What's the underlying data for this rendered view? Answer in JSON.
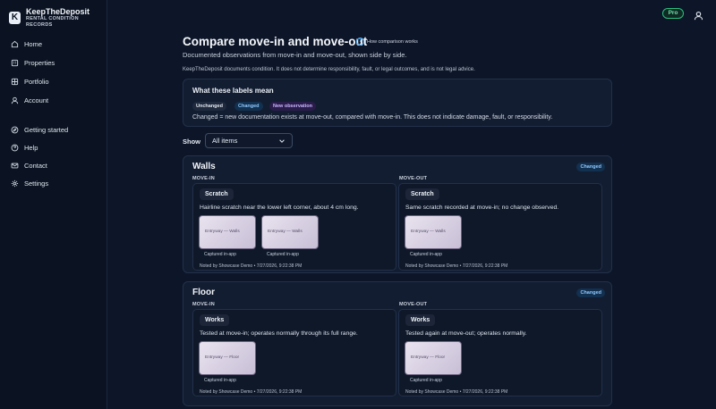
{
  "app": {
    "name": "KeepTheDeposit",
    "tagline": "RENTAL CONDITION RECORDS",
    "logo_letter": "K",
    "plan_badge": "Pro"
  },
  "sidebar": {
    "primary": [
      {
        "label": "Home",
        "icon": "home-icon"
      },
      {
        "label": "Properties",
        "icon": "building-icon"
      },
      {
        "label": "Portfolio",
        "icon": "grid-icon"
      },
      {
        "label": "Account",
        "icon": "user-icon"
      }
    ],
    "secondary": [
      {
        "label": "Getting started",
        "icon": "compass-icon"
      },
      {
        "label": "Help",
        "icon": "help-circle-icon"
      },
      {
        "label": "Contact",
        "icon": "mail-icon"
      },
      {
        "label": "Settings",
        "icon": "gear-icon"
      }
    ]
  },
  "page": {
    "title": "Compare move-in and move-out",
    "how_link": "How comparison works",
    "subtitle": "Documented observations from move-in and move-out, shown side by side.",
    "disclaimer": "KeepTheDeposit documents condition. It does not determine responsibility, fault, or legal outcomes, and is not legal advice."
  },
  "labels_card": {
    "heading": "What these labels mean",
    "chips": {
      "unchanged": "Unchanged",
      "changed": "Changed",
      "new": "New observation"
    },
    "explanation": "Changed = new documentation exists at move-out, compared with move-in. This does not indicate damage, fault, or responsibility."
  },
  "filter": {
    "label": "Show",
    "value": "All items"
  },
  "sections": [
    {
      "title": "Walls",
      "badge": "Changed",
      "move_in_label": "MOVE-IN",
      "move_out_label": "MOVE-OUT",
      "move_in": {
        "tag": "Scratch",
        "description": "Hairline scratch near the lower left corner, about 4 cm long.",
        "photos": [
          {
            "caption": "Entryway — Walls",
            "meta": "Captured in-app"
          },
          {
            "caption": "Entryway — Walls",
            "meta": "Captured in-app"
          }
        ],
        "noted": "Noted by Showcase Demo • 7/27/2026, 9:22:38 PM"
      },
      "move_out": {
        "tag": "Scratch",
        "description": "Same scratch recorded at move-in; no change observed.",
        "photos": [
          {
            "caption": "Entryway — Walls",
            "meta": "Captured in-app"
          }
        ],
        "noted": "Noted by Showcase Demo • 7/27/2026, 9:22:38 PM"
      }
    },
    {
      "title": "Floor",
      "badge": "Changed",
      "move_in_label": "MOVE-IN",
      "move_out_label": "MOVE-OUT",
      "move_in": {
        "tag": "Works",
        "description": "Tested at move-in; operates normally through its full range.",
        "photos": [
          {
            "caption": "Entryway — Floor",
            "meta": "Captured in-app"
          }
        ],
        "noted": "Noted by Showcase Demo • 7/27/2026, 9:22:38 PM"
      },
      "move_out": {
        "tag": "Works",
        "description": "Tested again at move-out; operates normally.",
        "photos": [
          {
            "caption": "Entryway — Floor",
            "meta": "Captured in-app"
          }
        ],
        "noted": "Noted by Showcase Demo • 7/27/2026, 9:22:38 PM"
      }
    }
  ]
}
